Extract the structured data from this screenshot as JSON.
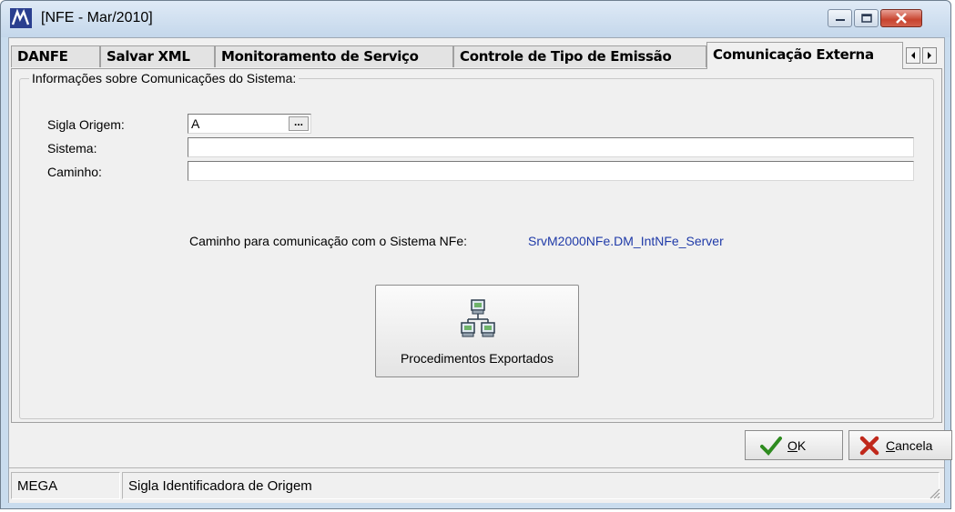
{
  "window": {
    "title": "[NFE - Mar/2010]"
  },
  "tabs": [
    {
      "label": "DANFE"
    },
    {
      "label": "Salvar XML"
    },
    {
      "label": "Monitoramento de Serviço"
    },
    {
      "label": "Controle de Tipo de Emissão"
    },
    {
      "label": "Comunicação Externa",
      "active": true
    }
  ],
  "group": {
    "title": "Informações sobre Comunicações do Sistema:",
    "sigla_label": "Sigla Origem:",
    "sigla_value": "A",
    "lookup_label": "...",
    "sistema_label": "Sistema:",
    "sistema_value": "",
    "caminho_label": "Caminho:",
    "caminho_value": "",
    "comm_text": "Caminho para comunicação com o Sistema NFe:",
    "comm_path": "SrvM2000NFe.DM_IntNFe_Server",
    "exported_button": "Procedimentos Exportados"
  },
  "footer": {
    "ok_prefix": "",
    "ok_mnemonic": "O",
    "ok_rest": "K",
    "cancel_mnemonic": "C",
    "cancel_rest": "ancela"
  },
  "status": {
    "panel1": "MEGA",
    "panel2": "Sigla Identificadora de Origem"
  },
  "colors": {
    "link": "#1f3aa8",
    "ok_check": "#2e8b1f",
    "cancel_x": "#c0281b"
  },
  "icons": {
    "app": "mega-logo-icon",
    "minimize": "minimize-icon",
    "maximize": "maximize-icon",
    "close": "close-icon",
    "network": "network-computers-icon",
    "ok": "checkmark-icon",
    "cancel": "x-mark-icon"
  }
}
